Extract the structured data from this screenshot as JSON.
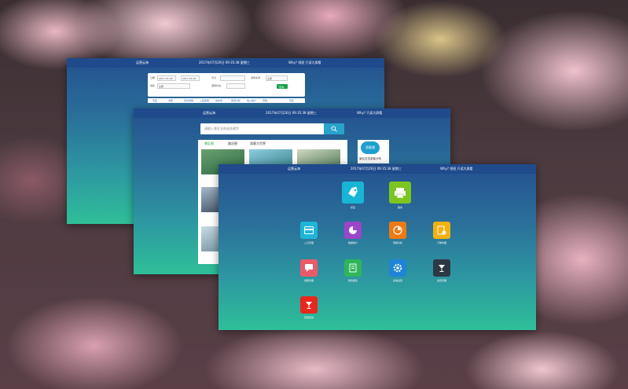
{
  "screen1": {
    "title": "运营云海",
    "datetime": "2017年07月26日 09:35:38 星期三",
    "user": "Why? 领班 只读大屏看",
    "form": {
      "from_label": "日期",
      "from_value": "2017-07-26",
      "to_value": "2017-07-26",
      "field2": "景点",
      "field3": "游客来源",
      "field4": "地区",
      "field5": "全部",
      "field6": "全部",
      "field7": "游客状态",
      "query": "查询"
    },
    "strip": [
      "景区",
      "游客",
      "实时游客",
      "入园游客",
      "停车场",
      "客流分析",
      "收入统计",
      "营销",
      "景区"
    ]
  },
  "screen2": {
    "title": "运营云海",
    "datetime": "2017年07月26日 09:35:38 星期三",
    "user": "Why? 只读大屏看",
    "search_placeholder": "请输入景区名称或关键字",
    "tabs": [
      "景区图",
      "路况图",
      "游客大世界"
    ],
    "badge": "游客通",
    "side_text": "景区总览游客分布"
  },
  "screen3": {
    "title": "运营云海",
    "datetime": "2017年07月26日 09:35:38 星期三",
    "user": "Why? 领班 只读大屏看",
    "apps": [
      {
        "label": "标签",
        "color": "#18b6d4",
        "icon": "tag-icon"
      },
      {
        "label": "票务",
        "color": "#7cc521",
        "icon": "printer-icon"
      },
      {
        "label": "入口管理",
        "color": "#1fb5d6",
        "icon": "card-icon"
      },
      {
        "label": "数据统计",
        "color": "#9b45c9",
        "icon": "pie-chart-icon"
      },
      {
        "label": "营销分析",
        "color": "#ee7a12",
        "icon": "pie-analysis-icon"
      },
      {
        "label": "订单管理",
        "color": "#f2b111",
        "icon": "order-icon"
      },
      {
        "label": "游客管理",
        "color": "#ea5a6a",
        "icon": "message-icon"
      },
      {
        "label": "财务报表",
        "color": "#2fb55a",
        "icon": "report-icon"
      },
      {
        "label": "系统设置",
        "color": "#1f84d8",
        "icon": "gear-icon"
      },
      {
        "label": "会员管理",
        "color": "#2d3845",
        "icon": "cup-icon"
      },
      {
        "label": "营销活动",
        "color": "#e8281f",
        "icon": "cup-red-icon"
      }
    ]
  }
}
